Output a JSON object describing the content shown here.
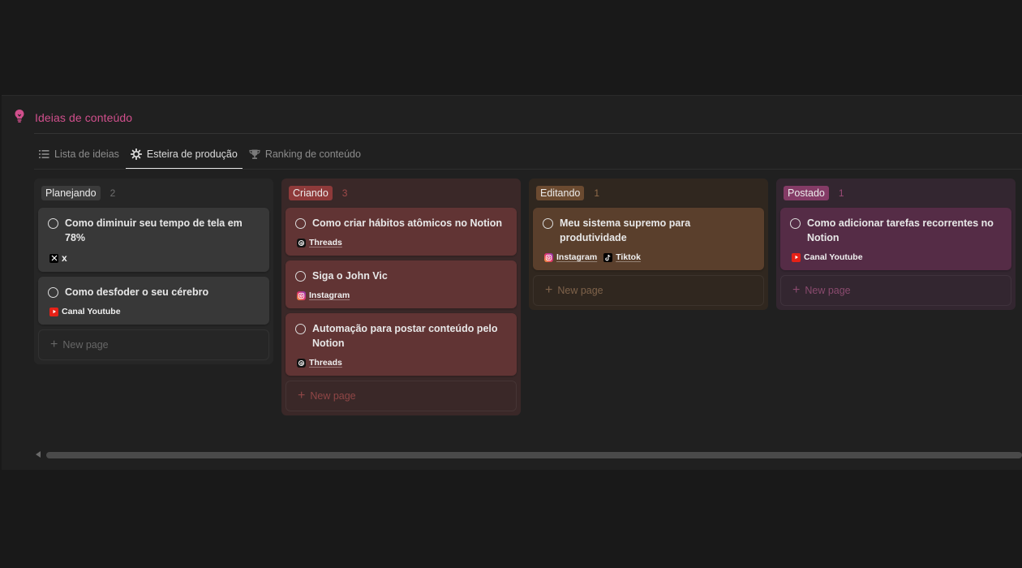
{
  "page": {
    "title": "Ideias de conteúdo",
    "icon": "lightbulb-icon"
  },
  "tabs": [
    {
      "label": "Lista de ideias",
      "icon": "list-icon",
      "active": false
    },
    {
      "label": "Esteira de produção",
      "icon": "gear-icon",
      "active": true
    },
    {
      "label": "Ranking de conteúdo",
      "icon": "trophy-icon",
      "active": false
    }
  ],
  "columns": [
    {
      "name": "Planejando",
      "count": "2",
      "cards": [
        {
          "title": "Como diminuir seu tempo de tela em 78%",
          "tags": [
            {
              "label": "x",
              "icon": "x-icon"
            }
          ]
        },
        {
          "title": "Como desfoder o seu cérebro",
          "tags": [
            {
              "label": "Canal Youtube",
              "icon": "youtube-icon"
            }
          ]
        }
      ],
      "new_page_label": "New page"
    },
    {
      "name": "Criando",
      "count": "3",
      "cards": [
        {
          "title": "Como criar hábitos atômicos no Notion",
          "tags": [
            {
              "label": "Threads",
              "icon": "threads-icon"
            }
          ]
        },
        {
          "title": "Siga o John Vic",
          "tags": [
            {
              "label": "Instagram",
              "icon": "instagram-icon"
            }
          ]
        },
        {
          "title": "Automação para postar conteúdo pelo Notion",
          "tags": [
            {
              "label": "Threads",
              "icon": "threads-icon"
            }
          ]
        }
      ],
      "new_page_label": "New page"
    },
    {
      "name": "Editando",
      "count": "1",
      "cards": [
        {
          "title": "Meu sistema supremo para produtividade",
          "tags": [
            {
              "label": "Instagram",
              "icon": "instagram-icon"
            },
            {
              "label": "Tiktok",
              "icon": "tiktok-icon"
            }
          ]
        }
      ],
      "new_page_label": "New page"
    },
    {
      "name": "Postado",
      "count": "1",
      "cards": [
        {
          "title": "Como adicionar tarefas recorrentes no Notion",
          "tags": [
            {
              "label": "Canal Youtube",
              "icon": "youtube-icon"
            }
          ]
        }
      ],
      "new_page_label": "New page"
    }
  ],
  "colors": {
    "title_accent": "#d04f8c",
    "planejando": "#3b3b3b",
    "criando": "#8e3a3a",
    "editando": "#6b4a30",
    "postado": "#843b66"
  }
}
